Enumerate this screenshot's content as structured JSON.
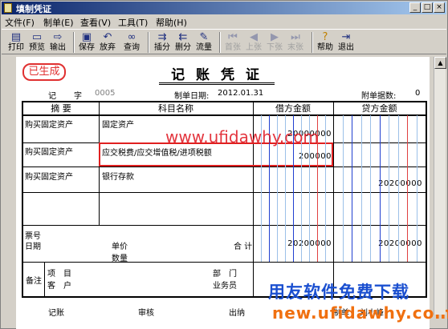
{
  "window": {
    "title": "填制凭证"
  },
  "menu": [
    {
      "label": "文件(F)"
    },
    {
      "label": "制单(E)"
    },
    {
      "label": "查看(V)"
    },
    {
      "label": "工具(T)"
    },
    {
      "label": "帮助(H)"
    }
  ],
  "toolbar": [
    {
      "label": "打印",
      "icon": "printer-icon",
      "enabled": true
    },
    {
      "label": "预览",
      "icon": "preview-icon",
      "enabled": true
    },
    {
      "label": "输出",
      "icon": "output-icon",
      "enabled": true
    },
    {
      "label": "保存",
      "icon": "save-icon",
      "enabled": true
    },
    {
      "label": "放弃",
      "icon": "undo-icon",
      "enabled": true
    },
    {
      "label": "查询",
      "icon": "binoculars-icon",
      "enabled": true
    },
    {
      "label": "插分",
      "icon": "insert-row-icon",
      "enabled": true
    },
    {
      "label": "删分",
      "icon": "delete-row-icon",
      "enabled": true
    },
    {
      "label": "流量",
      "icon": "cashflow-icon",
      "enabled": true
    },
    {
      "label": "首张",
      "icon": "first-icon",
      "enabled": false
    },
    {
      "label": "上张",
      "icon": "prev-icon",
      "enabled": false
    },
    {
      "label": "下张",
      "icon": "next-icon",
      "enabled": false
    },
    {
      "label": "末张",
      "icon": "last-icon",
      "enabled": false
    },
    {
      "label": "帮助",
      "icon": "help-icon",
      "enabled": true
    },
    {
      "label": "退出",
      "icon": "exit-icon",
      "enabled": true
    }
  ],
  "voucher": {
    "stamp": "已生成",
    "title": "记 账 凭 证",
    "type_label": "记",
    "zi_label": "字",
    "number": "0005",
    "date_label": "制单日期:",
    "date": "2012.01.31",
    "attach_label": "附单据数:",
    "attach_count": "0",
    "headers": {
      "summary": "摘 要",
      "account": "科目名称",
      "debit": "借方金额",
      "credit": "贷方金额"
    },
    "entries": [
      {
        "summary": "购买固定资产",
        "account": "固定资产",
        "debit": "20000000",
        "credit": ""
      },
      {
        "summary": "购买固定资产",
        "account": "应交税费/应交增值税/进项税额",
        "debit": "200000",
        "credit": ""
      },
      {
        "summary": "购买固定资产",
        "account": "银行存款",
        "debit": "",
        "credit": "20200000"
      }
    ],
    "footer": {
      "ticket_label": "票号",
      "date_label": "日期",
      "price_label": "单价",
      "qty_label": "数量",
      "total_label": "合 计",
      "total_debit": "20200000",
      "total_credit": "20200000",
      "remark_label": "备注",
      "project_label": "项　目",
      "customer_label": "客　户",
      "dept_label": "部　门",
      "salesman_label": "业务员"
    },
    "signatures": {
      "bookkeeper": "记账",
      "auditor": "审核",
      "cashier": "出纳",
      "maker_label": "制单",
      "maker": "刘小峰"
    }
  },
  "watermark": "www.ufidawhy.com",
  "brand_cn": "用友软件免费下载",
  "brand_url": "new.ufidawhy.com",
  "colors": {
    "title_bar": "#0a246a",
    "stamp": "#e03030",
    "brand_blue": "#1a4fd0",
    "brand_orange": "#f07010"
  }
}
